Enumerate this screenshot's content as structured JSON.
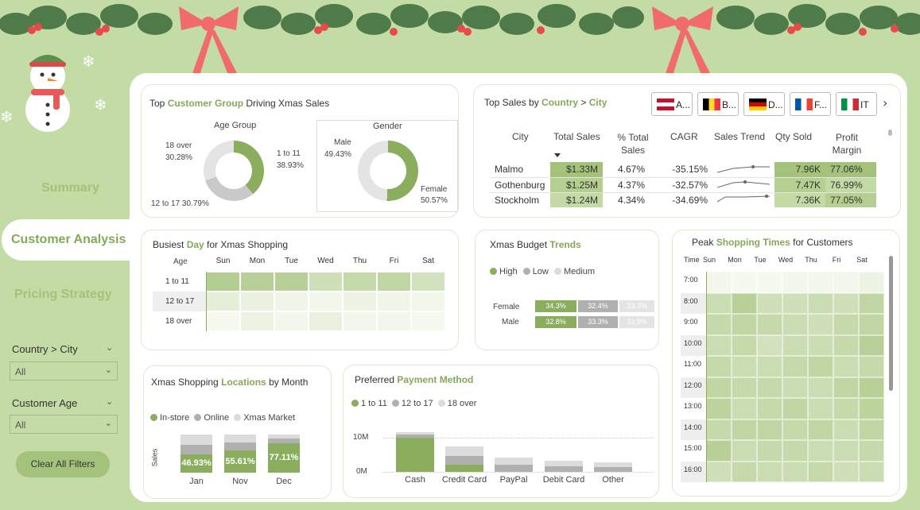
{
  "nav": {
    "summary": "Summary",
    "customer_analysis": "Customer Analysis",
    "pricing_strategy": "Pricing Strategy"
  },
  "filters": {
    "country_city_label": "Country > City",
    "country_city_value": "All",
    "customer_age_label": "Customer Age",
    "customer_age_value": "All",
    "clear_button": "Clear All Filters"
  },
  "colors": {
    "background": "#c3dba4",
    "accent": "#84a959",
    "dark_green": "#8aad5e",
    "light_grey": "#d6d6d6",
    "mid_grey": "#aaaaaa",
    "red": "#f06464"
  },
  "customer_group": {
    "title_pre": "Top ",
    "title_em": "Customer Group",
    "title_post": " Driving Xmas Sales",
    "age": {
      "title": "Age Group",
      "l1a": "18 over",
      "l1b": "30.28%",
      "l2a": "1 to 11",
      "l2b": "38.93%",
      "l3": "12 to 17 30.79%"
    },
    "gender": {
      "title": "Gender",
      "l1a": "Male",
      "l1b": "49.43%",
      "l2a": "Female",
      "l2b": "50.57%"
    }
  },
  "top_sales": {
    "title_pre": "Top Sales by ",
    "title_em1": "Country",
    "title_mid": " > ",
    "title_em2": "City",
    "flags": [
      "A...",
      "B...",
      "D...",
      "F...",
      "IT"
    ],
    "headers": [
      "City",
      "Total Sales",
      "% Total Sales",
      "CAGR",
      "Sales Trend",
      "Qty Sold",
      "Profit Margin"
    ],
    "rows": [
      {
        "city": "Malmo",
        "total": "$1.33M",
        "pct": "4.67%",
        "cagr": "-35.15%",
        "qty": "7.96K",
        "margin": "77.06%"
      },
      {
        "city": "Gothenburg",
        "total": "$1.25M",
        "pct": "4.37%",
        "cagr": "-32.57%",
        "qty": "7.47K",
        "margin": "76.99%"
      },
      {
        "city": "Stockholm",
        "total": "$1.24M",
        "pct": "4.34%",
        "cagr": "-34.69%",
        "qty": "7.36K",
        "margin": "77.05%"
      }
    ]
  },
  "busiest_day": {
    "title_pre": "Busiest ",
    "title_em": "Day",
    "title_post": " for Xmas Shopping",
    "col_header": "Age",
    "days": [
      "Sun",
      "Mon",
      "Tue",
      "Wed",
      "Thu",
      "Fri",
      "Sat"
    ],
    "rows": [
      {
        "label": "1 to 11",
        "levels": [
          0.75,
          0.7,
          0.7,
          0.45,
          0.55,
          0.6,
          0.4
        ]
      },
      {
        "label": "12 to 17",
        "levels": [
          0.2,
          0.15,
          0.08,
          0.05,
          0.1,
          0.08,
          0.06
        ]
      },
      {
        "label": "18 over",
        "levels": [
          0.02,
          0.12,
          0.05,
          0.15,
          0.05,
          0.05,
          0.03
        ]
      }
    ]
  },
  "budget": {
    "title_pre": "Xmas Budget ",
    "title_em": "Trends",
    "legend": [
      "High",
      "Low",
      "Medium"
    ],
    "rows": [
      {
        "label": "Female",
        "values": [
          "34.3%",
          "32.4%",
          "33.3%"
        ]
      },
      {
        "label": "Male",
        "values": [
          "32.8%",
          "33.3%",
          "33.9%"
        ]
      }
    ]
  },
  "peak_times": {
    "title_pre": "Peak ",
    "title_em": "Shopping Times",
    "title_post": " for Customers",
    "col_header": "Time",
    "days": [
      "Sun",
      "Mon",
      "Tue",
      "Wed",
      "Thu",
      "Fri",
      "Sat"
    ],
    "times": [
      "7:00",
      "8:00",
      "9:00",
      "10:00",
      "11:00",
      "12:00",
      "13:00",
      "14:00",
      "15:00",
      "16:00"
    ]
  },
  "locations": {
    "title_pre": "Xmas Shopping ",
    "title_em": "Locations",
    "title_post": " by Month",
    "legend": [
      "In-store",
      "Online",
      "Xmas Market"
    ],
    "y_label": "Sales",
    "bars": [
      {
        "month": "Jan",
        "label": "46.93%"
      },
      {
        "month": "Nov",
        "label": "55.61%"
      },
      {
        "month": "Dec",
        "label": "77.11%"
      }
    ]
  },
  "payment": {
    "title_pre": "Preferred ",
    "title_em": "Payment Method",
    "legend": [
      "1 to 11",
      "12 to 17",
      "18 over"
    ],
    "y_ticks": [
      "10M",
      "0M"
    ],
    "methods": [
      "Cash",
      "Credit Card",
      "PayPal",
      "Debit Card",
      "Other"
    ]
  }
}
